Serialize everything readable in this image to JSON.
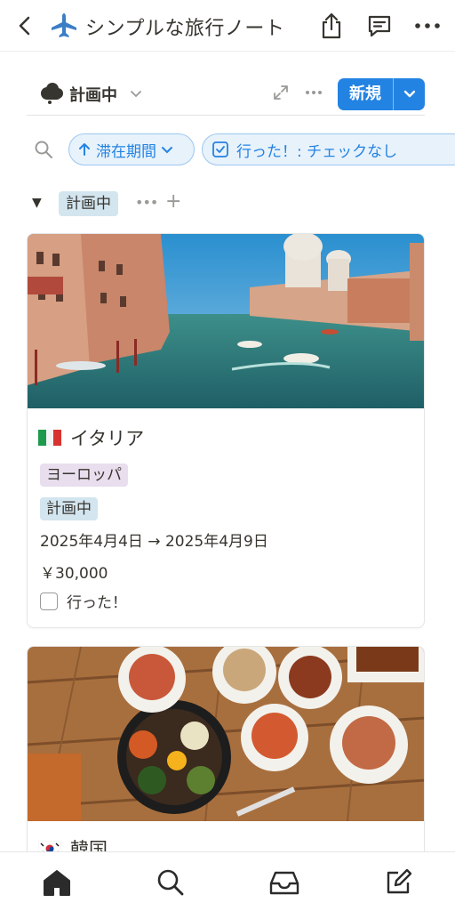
{
  "header": {
    "page_title": "シンプルな旅行ノート",
    "icons": {
      "back": "chevron-left-icon",
      "page": "airplane-icon",
      "share": "share-icon",
      "comments": "comment-icon",
      "more": "more-horizontal-icon"
    }
  },
  "view": {
    "name": "計画中",
    "icon": "cloud-icon",
    "new_label": "新規"
  },
  "filters": {
    "sort_chip": "滞在期間",
    "filter_chip": "行った！: チェックなし"
  },
  "group": {
    "label": "計画中",
    "more": "•••",
    "add": "+"
  },
  "cards": [
    {
      "flag": "italy-flag",
      "title": "イタリア",
      "tags": [
        "ヨーロッパ",
        "計画中"
      ],
      "date": "2025年4月4日 → 2025年4月9日",
      "price": "￥30,000",
      "checkbox_label": "行った！",
      "checked": false,
      "cover": "venice-canal-photo"
    },
    {
      "flag": "korea-flag",
      "title": "韓国",
      "cover": "korean-food-photo"
    }
  ],
  "bottom_nav": [
    "home-icon",
    "search-icon",
    "inbox-icon",
    "edit-icon"
  ],
  "colors": {
    "accent": "#2383e2",
    "text": "#37352f",
    "muted": "#9b9a97",
    "tag_purple": "#e8deee",
    "tag_blue": "#d3e5ef"
  }
}
